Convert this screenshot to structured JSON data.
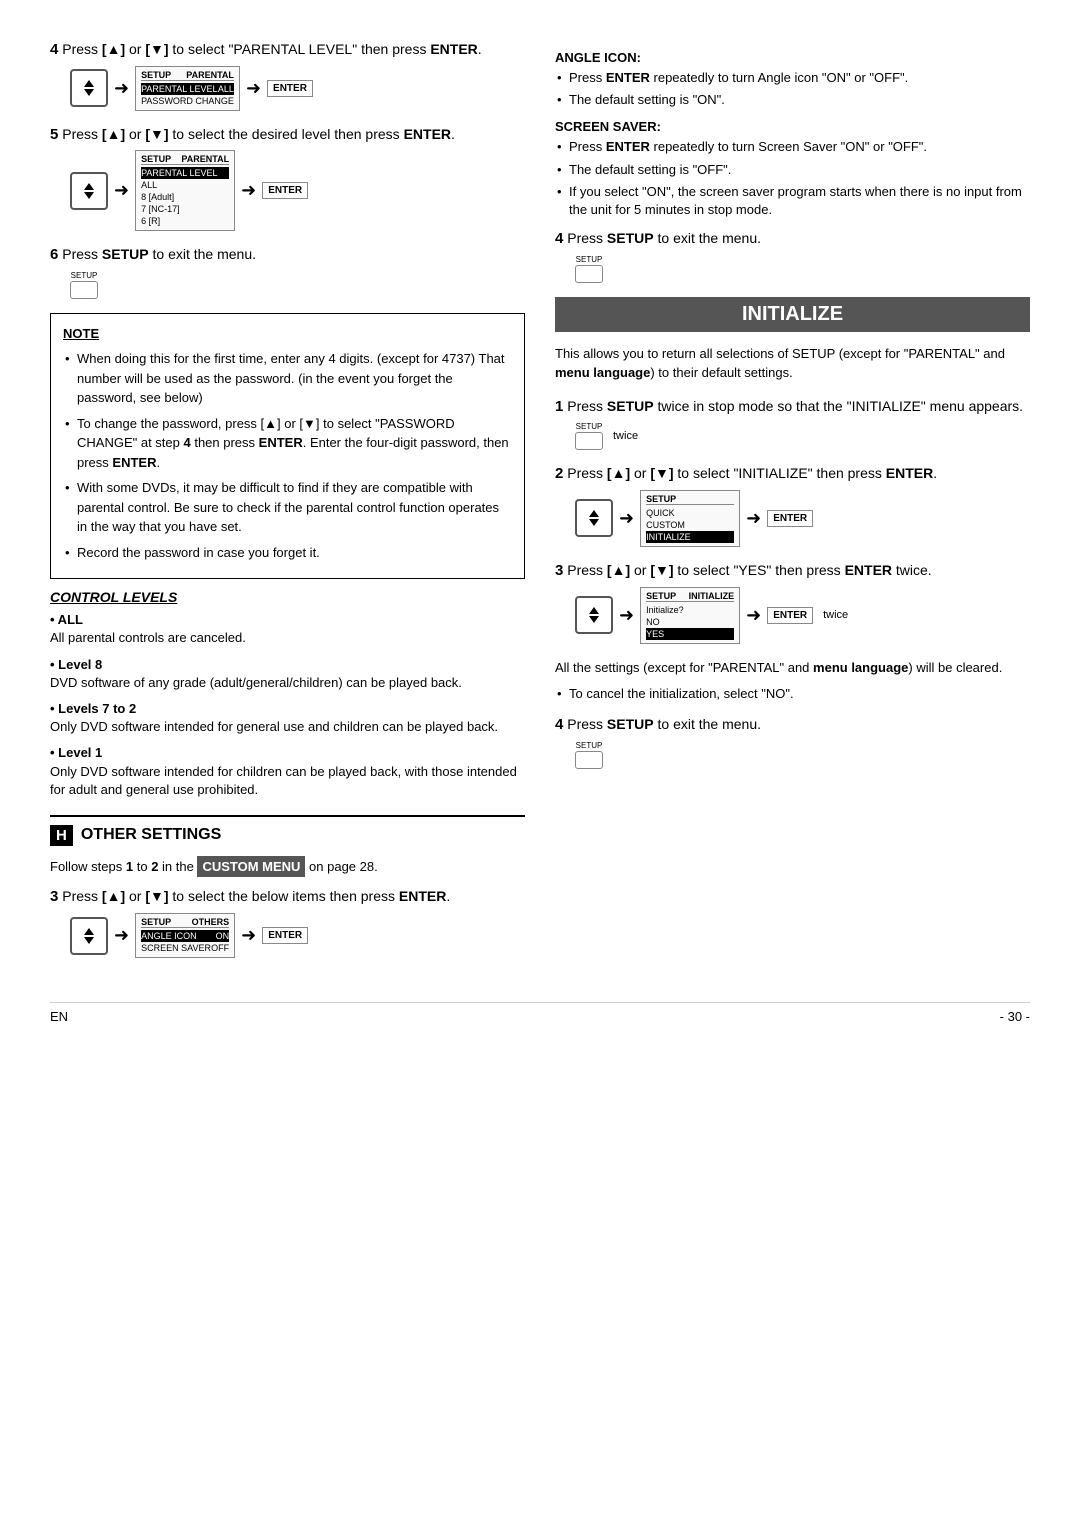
{
  "page": {
    "footer": {
      "left": "EN",
      "right": "- 30 -"
    }
  },
  "left": {
    "step4": {
      "text": "Press ",
      "key1": "[▲]",
      "or": " or ",
      "key2": "[▼]",
      "text2": " to select \"PARENTAL LEVEL\" then press ",
      "enter": "ENTER",
      "text3": "."
    },
    "step5": {
      "text": "Press ",
      "key1": "[▲]",
      "or": " or ",
      "key2": "[▼]",
      "text2": " to select the desired level then press ",
      "enter": "ENTER",
      "text3": "."
    },
    "step6": {
      "text": "Press ",
      "setup": "SETUP",
      "text2": " to exit the menu."
    },
    "note_title": "NOTE",
    "note_items": [
      "When doing this for the first time, enter any 4 digits. (except for 4737) That number will be used as the password. (in the event you forget the password, see below)",
      "To change the password, press [▲] or [▼] to select \"PASSWORD CHANGE\" at step 4 then press ENTER. Enter the four-digit password, then press ENTER.",
      "With some DVDs, it may be difficult to find if they are compatible with parental control. Be sure to check if the parental control function operates in the way that you have set.",
      "Record the password in case you forget it."
    ],
    "control_levels": {
      "title": "CONTROL LEVELS",
      "items": [
        {
          "label": "ALL",
          "bold": true,
          "desc": "All parental controls are canceled."
        },
        {
          "label": "Level 8",
          "bold": false,
          "desc": "DVD software of any grade (adult/general/children) can be played back."
        },
        {
          "label": "Levels 7 to 2",
          "bold": false,
          "desc": "Only DVD software intended for general use and children can be played back."
        },
        {
          "label": "Level 1",
          "bold": false,
          "desc": "Only DVD software intended for children can be played back, with those intended for adult and general use prohibited."
        }
      ]
    },
    "other_settings": {
      "h_label": "H",
      "title": "OTHER SETTINGS",
      "intro": "Follow steps ",
      "bold1": "1",
      "text2": " to ",
      "bold2": "2",
      "text3": " in the ",
      "custom_menu": "CUSTOM MENU",
      "text4": " on page 28."
    },
    "step3_other": {
      "text": "Press ",
      "key1": "[▲]",
      "or": " or ",
      "key2": "[▼]",
      "text2": " to select the below items then press ",
      "enter": "ENTER",
      "text3": "."
    },
    "screens": {
      "parental_level_screen": {
        "header_left": "SETUP",
        "header_right": "PARENTAL",
        "rows": [
          {
            "label": "PARENTAL LEVEL",
            "value": "ALL",
            "highlighted": true
          },
          {
            "label": "PASSWORD CHANGE",
            "value": "",
            "highlighted": false
          }
        ]
      },
      "parental_level_screen2": {
        "header_left": "SETUP",
        "header_right": "PARENTAL",
        "rows": [
          {
            "label": "PARENTAL LEVEL",
            "value": "",
            "highlighted": true
          },
          {
            "label": "ALL",
            "value": "",
            "highlighted": false
          },
          {
            "label": "8 [Adult]",
            "value": "",
            "highlighted": false
          },
          {
            "label": "7 [NC-17]",
            "value": "",
            "highlighted": false
          },
          {
            "label": "6 [R]",
            "value": "",
            "highlighted": false
          }
        ]
      },
      "others_screen": {
        "header_left": "SETUP",
        "header_right": "OTHERS",
        "rows": [
          {
            "label": "ANGLE ICON",
            "value": "ON",
            "highlighted": true
          },
          {
            "label": "SCREEN SAVER",
            "value": "OFF",
            "highlighted": false
          }
        ]
      }
    }
  },
  "right": {
    "angle_icon": {
      "title": "ANGLE ICON:",
      "items": [
        "Press ENTER repeatedly to turn Angle icon \"ON\" or \"OFF\".",
        "The default setting is \"ON\"."
      ]
    },
    "screen_saver": {
      "title": "SCREEN SAVER:",
      "items": [
        "Press ENTER repeatedly to turn Screen Saver \"ON\" or \"OFF\".",
        "The default setting is \"OFF\".",
        "If you select \"ON\", the screen saver program starts when there is no input from the unit for 5 minutes in stop mode."
      ]
    },
    "step4_exit": {
      "text": "Press ",
      "setup": "SETUP",
      "text2": " to exit the menu."
    },
    "initialize": {
      "title": "INITIALIZE",
      "intro": "This allows you to return all selections of SETUP (except for \"PARENTAL\" and ",
      "bold1": "menu language",
      "text2": ") to their default settings."
    },
    "step1": {
      "text": "Press ",
      "bold1": "SETUP",
      "text2": " twice in stop mode so that the \"INITIALIZE\" menu appears.",
      "twice": "twice"
    },
    "step2": {
      "text": "Press ",
      "key1": "[▲]",
      "or": " or ",
      "key2": "[▼]",
      "text2": " to select \"INITIALIZE\" then press ",
      "enter": "ENTER",
      "text3": "."
    },
    "step3": {
      "text": "Press ",
      "key1": "[▲]",
      "or": " or ",
      "key2": "[▼]",
      "text2": " to select \"YES\" then press ",
      "enter": "ENTER",
      "text3": " twice.",
      "twice": "twice"
    },
    "step3_info": {
      "text": "All the settings (except for \"PARENTAL\" and ",
      "bold1": "menu language",
      "text2": ") will be cleared.",
      "bullet": "To cancel the initialization, select \"NO\"."
    },
    "step4_final": {
      "text": "Press ",
      "bold1": "SETUP",
      "text2": " to exit the menu."
    },
    "init_screens": {
      "setup_screen": {
        "header_left": "SETUP",
        "rows": [
          {
            "label": "QUICK",
            "highlighted": false
          },
          {
            "label": "CUSTOM",
            "highlighted": false
          },
          {
            "label": "INITIALIZE",
            "highlighted": true
          }
        ]
      },
      "initialize_screen": {
        "header_left": "SETUP",
        "header_right": "INITIALIZE",
        "rows": [
          {
            "label": "Initialize?",
            "highlighted": false
          },
          {
            "label": "NO",
            "highlighted": false
          },
          {
            "label": "YES",
            "highlighted": true
          }
        ]
      }
    }
  }
}
